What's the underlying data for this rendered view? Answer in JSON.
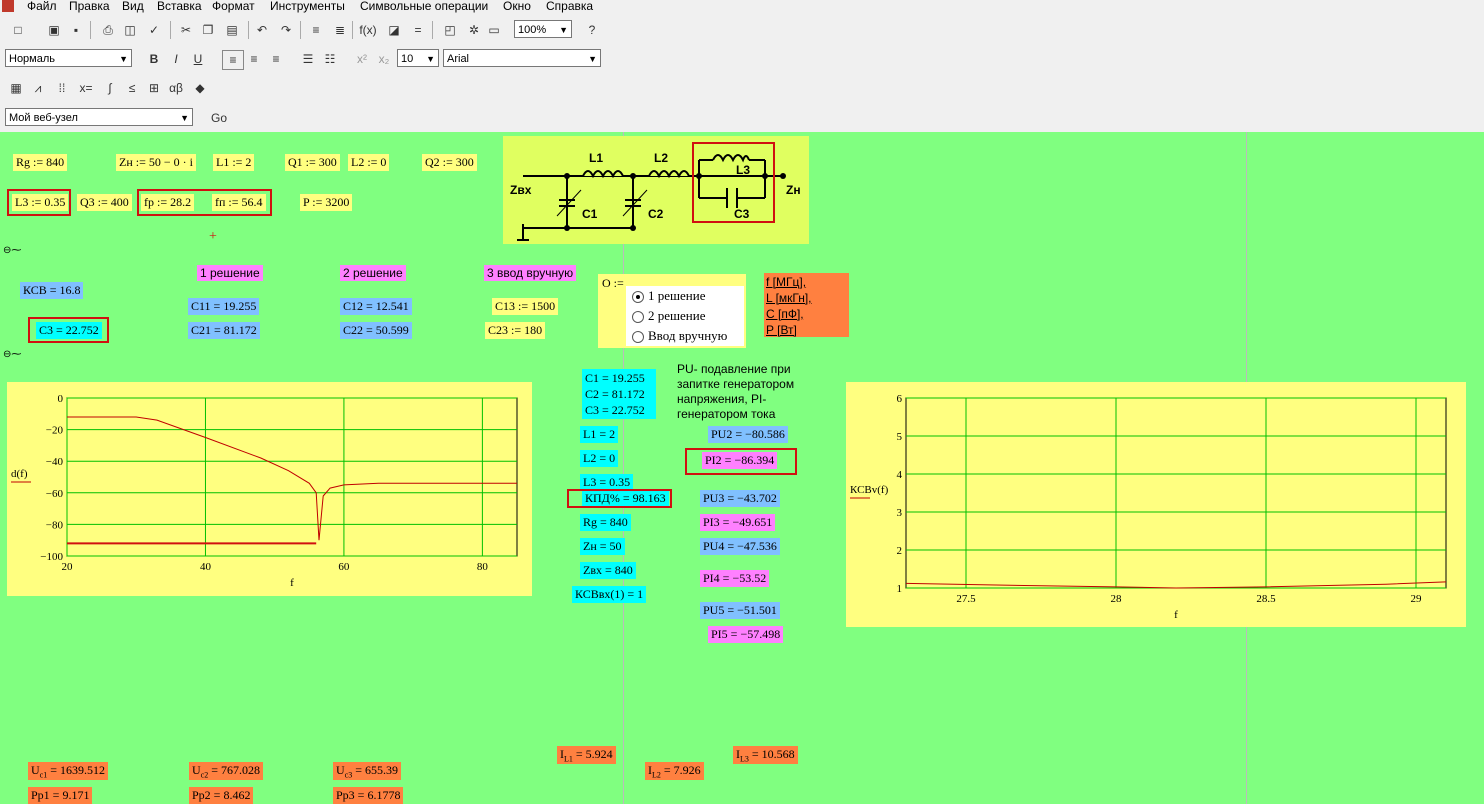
{
  "menu": [
    "Файл",
    "Правка",
    "Вид",
    "Вставка",
    "Формат",
    "Инструменты",
    "Символьные операции",
    "Окно",
    "Справка"
  ],
  "toolbar": {
    "zoom": "100%",
    "style": "Нормаль",
    "font_size": "10",
    "font": "Arial",
    "website": "Мой веб-узел",
    "go": "Go"
  },
  "vars": {
    "rg": "Rg := 840",
    "zn": "Zн := 50 − 0 · i",
    "l1": "L1 := 2",
    "q1": "Q1 := 300",
    "l2": "L2 := 0",
    "q2": "Q2 := 300",
    "l3": "L3 := 0.35",
    "q3": "Q3 := 400",
    "fp": "fр := 28.2",
    "fn": "fп := 56.4",
    "p": "P := 3200"
  },
  "plus": "+",
  "headers": {
    "s1": "1 решение",
    "s2": "2 решение",
    "s3": "3 ввод вручную"
  },
  "ksv": "КСВ = 16.8",
  "c3": "C3 = 22.752",
  "c11": "C11 = 19.255",
  "c21": "C21 = 81.172",
  "c12": "C12 = 12.541",
  "c22": "C22 = 50.599",
  "c13": "C13 := 1500",
  "c23": "C23 := 180",
  "option": {
    "label": "O :=",
    "opts": [
      "1 решение",
      "2 решение",
      "Ввод вручную"
    ],
    "selected": 0
  },
  "units": [
    "f [МГц],",
    "L [мкГн],",
    "C [пФ],",
    "P [Вт]"
  ],
  "schematic": {
    "zin": "Zвх",
    "zn": "Zн",
    "l1": "L1",
    "l2": "L2",
    "l3": "L3",
    "c1": "C1",
    "c2": "C2",
    "c3": "C3"
  },
  "results": {
    "c1": "C1 = 19.255",
    "c2": "C2 = 81.172",
    "c3": "C3 = 22.752",
    "l1": "L1 = 2",
    "l2": "L2 = 0",
    "l3": "L3 = 0.35",
    "kpd": "КПД% = 98.163",
    "rg": "Rg = 840",
    "zn": "Zн = 50",
    "zin": "Zвх = 840",
    "ksv": "КСВвх(1) = 1"
  },
  "note": "PU- подавление при запитке генератором напряжения, PI- генератором тока",
  "pu": {
    "pu2": "PU2 = −80.586",
    "pi2": "PI2 = −86.394",
    "pu3": "PU3 = −43.702",
    "pi3": "PI3 = −49.651",
    "pu4": "PU4 = −47.536",
    "pi4": "PI4 = −53.52",
    "pu5": "PU5 = −51.501",
    "pi5": "PI5 = −57.498"
  },
  "bottom": {
    "uc1_v": "= 1639.512",
    "uc2_v": "= 767.028",
    "uc3_v": "= 655.39",
    "pp1": "Pp1 = 9.171",
    "pp2": "Pp2 = 8.462",
    "pp3": "Pp3 = 6.1778",
    "il1_v": "= 5.924",
    "il2_v": "= 7.926",
    "il3_v": "= 10.568"
  },
  "chart_data": [
    {
      "type": "line",
      "ylabel": "d(f)",
      "xlabel": "f",
      "xlim": [
        20,
        85
      ],
      "ylim": [
        -100,
        0
      ],
      "xticks": [
        20,
        40,
        60,
        80
      ],
      "yticks": [
        0,
        -20,
        -40,
        -60,
        -80,
        -100
      ],
      "grid": true,
      "series": [
        {
          "x": [
            20,
            24,
            30,
            33,
            40,
            48,
            52,
            55,
            56,
            56.4,
            57,
            58,
            60,
            65,
            70,
            80,
            85
          ],
          "y": [
            -12,
            -12,
            -12,
            -14,
            -25,
            -38,
            -46,
            -54,
            -60,
            -90,
            -62,
            -57,
            -55,
            -54,
            -54,
            -54,
            -54
          ],
          "color": "#c00000"
        },
        {
          "x": [
            20,
            56
          ],
          "y": [
            -92,
            -92
          ],
          "color": "#d01010"
        }
      ]
    },
    {
      "type": "line",
      "ylabel": "КСВv(f)",
      "xlabel": "f",
      "xlim": [
        27.3,
        29.1
      ],
      "ylim": [
        1,
        6
      ],
      "xticks": [
        27.5,
        28,
        28.5,
        29
      ],
      "yticks": [
        1,
        2,
        3,
        4,
        5,
        6
      ],
      "grid": true,
      "series": [
        {
          "x": [
            27.3,
            27.6,
            28,
            28.2,
            28.5,
            28.9,
            29.1
          ],
          "y": [
            1.12,
            1.08,
            1.03,
            1.0,
            1.03,
            1.1,
            1.16
          ],
          "color": "#c00000"
        }
      ]
    }
  ]
}
